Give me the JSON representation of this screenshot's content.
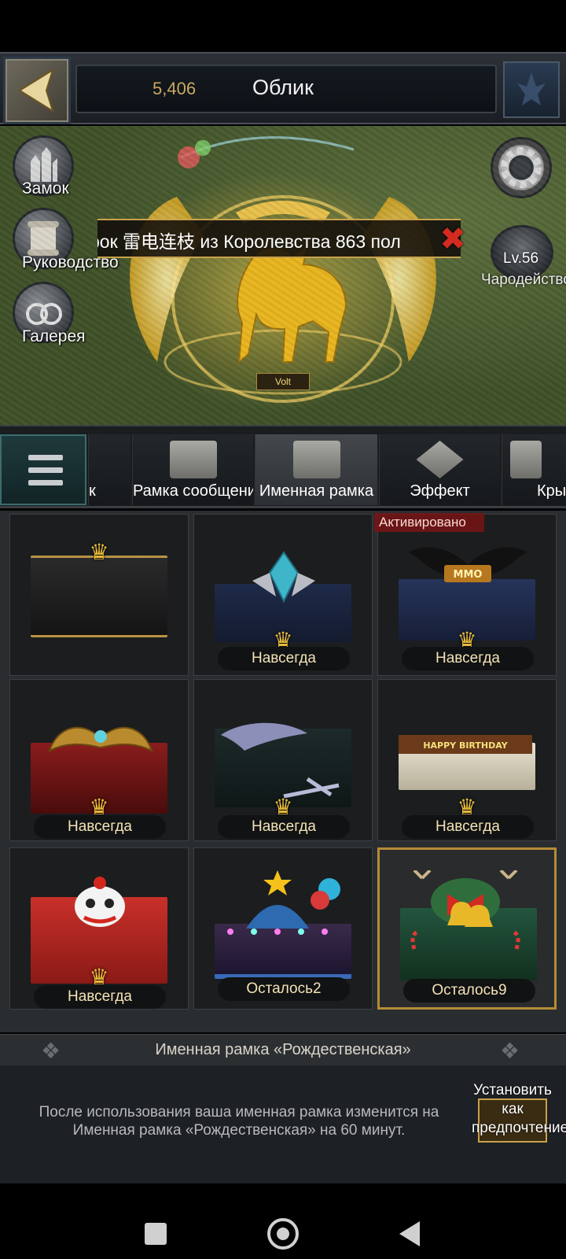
{
  "header": {
    "coins": "5,406",
    "title": "Облик"
  },
  "scene": {
    "left_buttons": [
      {
        "label": "Замок",
        "icon": "castle-icon"
      },
      {
        "label": "Руководство",
        "icon": "scroll-icon"
      },
      {
        "label": "Галерея",
        "icon": "gallery-icon"
      }
    ],
    "banner_text": "рок 雷电连枝 из Королевства 863 пол",
    "level": "Lv.56",
    "enchant_label": "Чародейство",
    "player_name": "Volt"
  },
  "tabs": [
    {
      "label": "к",
      "active": false
    },
    {
      "label": "Рамка сообщений",
      "active": false
    },
    {
      "label": "Именная рамка",
      "active": true
    },
    {
      "label": "Эффект",
      "active": false
    },
    {
      "label": "Кры",
      "active": false
    }
  ],
  "grid": {
    "active_badge": "Активировано",
    "cells": [
      {
        "tag": "",
        "art": "plain",
        "selected": false
      },
      {
        "tag": "Навсегда",
        "art": "crystal",
        "selected": false
      },
      {
        "tag": "Навсегда",
        "art": "mustache",
        "emblem_text": "MMO",
        "selected": false
      },
      {
        "tag": "Навсегда",
        "art": "dragon",
        "selected": false
      },
      {
        "tag": "Навсегда",
        "art": "feather",
        "selected": false
      },
      {
        "tag": "Навсегда",
        "art": "birthday",
        "emblem_text": "HAPPY BIRTHDAY",
        "selected": false
      },
      {
        "tag": "Навсегда",
        "art": "lion",
        "selected": false
      },
      {
        "tag": "Осталось2",
        "art": "carnival",
        "selected": false
      },
      {
        "tag": "Осталось9",
        "art": "christmas",
        "selected": true
      }
    ]
  },
  "detail": {
    "name": "Именная рамка «Рождественская»",
    "description": "После использования ваша именная рамка изменится на Именная рамка «Рождественская» на 60 минут.",
    "set_preference_label": "Установить как предпочтение"
  },
  "colors": {
    "gold": "#c9a24c",
    "selected_border": "#b58b36",
    "active_badge_bg": "#781414"
  }
}
